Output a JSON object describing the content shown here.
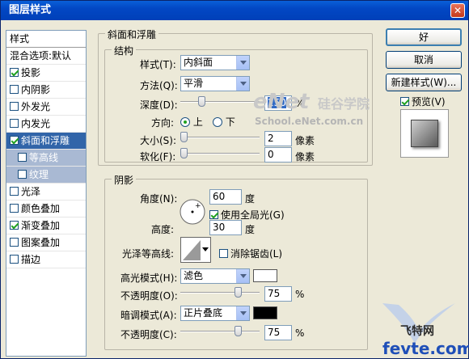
{
  "window": {
    "title": "图层样式"
  },
  "colors": {
    "titlebar": "#0a55d1",
    "selection": "#3165a9",
    "highlight": "#ffffff",
    "shadow": "#000000"
  },
  "stylelist": {
    "header": "样式",
    "blend": "混合选项:默认",
    "items": [
      {
        "label": "投影",
        "checked": true
      },
      {
        "label": "内阴影",
        "checked": false
      },
      {
        "label": "外发光",
        "checked": false
      },
      {
        "label": "内发光",
        "checked": false
      },
      {
        "label": "斜面和浮雕",
        "checked": true,
        "selected": true
      },
      {
        "label": "等高线",
        "checked": false,
        "sub": true
      },
      {
        "label": "纹理",
        "checked": false,
        "sub": true
      },
      {
        "label": "光泽",
        "checked": false
      },
      {
        "label": "颜色叠加",
        "checked": false
      },
      {
        "label": "渐变叠加",
        "checked": true
      },
      {
        "label": "图案叠加",
        "checked": false
      },
      {
        "label": "描边",
        "checked": false
      }
    ]
  },
  "bevel": {
    "group_title": "斜面和浮雕",
    "structure_title": "结构",
    "style_label": "样式(T):",
    "style_value": "内斜面",
    "technique_label": "方法(Q):",
    "technique_value": "平滑",
    "depth_label": "深度(D):",
    "depth_value": "250",
    "depth_level": 0.25,
    "percent": "%",
    "direction_label": "方向:",
    "dir_up": "上",
    "dir_down": "下",
    "size_label": "大小(S):",
    "size_value": "2",
    "size_level": 0.0,
    "soften_label": "软化(F):",
    "soften_value": "0",
    "soften_level": 0.0,
    "pixels": "像素"
  },
  "shading": {
    "title": "阴影",
    "angle_label": "角度(N):",
    "angle_value": "60",
    "degree": "度",
    "global_light": "使用全局光(G)",
    "altitude_label": "高度:",
    "altitude_value": "30",
    "gloss_label": "光泽等高线:",
    "antialias": "消除锯齿(L)",
    "highlight_mode_label": "高光模式(H):",
    "highlight_mode_value": "滤色",
    "opacity_label_1": "不透明度(O):",
    "opacity_value_1": "75",
    "opacity_level_1": 0.75,
    "shadow_mode_label": "暗调模式(A):",
    "shadow_mode_value": "正片叠底",
    "opacity_label_2": "不透明度(C):",
    "opacity_value_2": "75",
    "opacity_level_2": 0.75
  },
  "buttons": {
    "ok": "好",
    "cancel": "取消",
    "new_style": "新建样式(W)...",
    "preview": "预览(V)"
  },
  "watermarks": {
    "enet": "eNet",
    "enet_cn": "硅谷学院",
    "school": "School.eNet.com.cn",
    "feite": "飞特网",
    "fevte": "fevte.com"
  }
}
